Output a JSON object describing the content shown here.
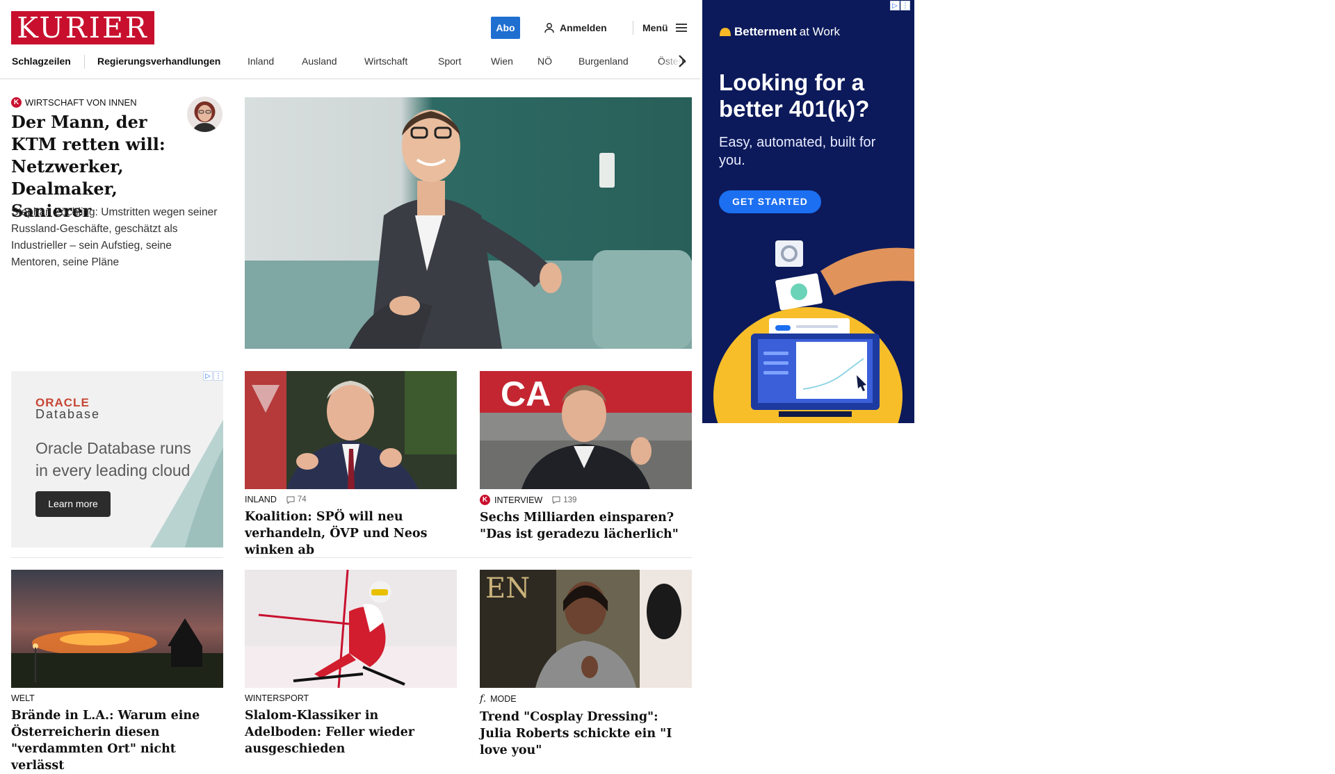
{
  "header": {
    "logo_text": "KURIER",
    "abo_label": "Abo",
    "login_label": "Anmelden",
    "menu_label": "Menü"
  },
  "nav": {
    "items": [
      "Schlagzeilen",
      "Regierungsverhandlungen",
      "Inland",
      "Ausland",
      "Wirtschaft",
      "Sport",
      "Wien",
      "NÖ",
      "Burgenland",
      "Österreich"
    ]
  },
  "lead": {
    "kicker": "WIRTSCHAFT VON INNEN",
    "title": "Der Mann, der KTM retten will: Netz­werker, Dealmaker, Sanierer",
    "teaser": "Stephan Zöchling: Umstritten wegen seiner Russland-Geschäfte, geschätzt als Industrieller – sein Aufstieg, seine Mentoren, seine Pläne"
  },
  "ad_oracle": {
    "brand": "ORACLE",
    "product": "Database",
    "headline": "Oracle Database runs in every leading cloud",
    "cta": "Learn more"
  },
  "ad_betterment": {
    "brand_bold": "Betterment",
    "brand_light": "at Work",
    "headline": "Looking for a better 401(k)?",
    "sub": "Easy, automated, built for you.",
    "cta": "GET STARTED"
  },
  "cards": [
    {
      "kicker": "INLAND",
      "comments": "74",
      "title": "Koalition: SPÖ will neu verhan­deln, ÖVP und Neos winken ab"
    },
    {
      "kicker": "INTERVIEW",
      "comments": "139",
      "title": "Sechs Milliarden einsparen? \"Das ist geradezu lächerlich\""
    },
    {
      "kicker": "WELT",
      "title": "Brände in L.A.: Warum eine Öster­reicherin diesen \"verdammten Ort\" nicht verlässt"
    },
    {
      "kicker": "WINTERSPORT",
      "title": "Slalom-Klassiker in Adelboden: Feller wieder ausgeschieden"
    },
    {
      "kicker": "MODE",
      "title": "Trend \"Cosplay Dressing\": Julia Roberts schickte ein \"I love you\""
    }
  ],
  "colors": {
    "brand_red": "#c8102e",
    "abo_blue": "#1f6fd1",
    "betterment_navy": "#0c1a5b"
  }
}
